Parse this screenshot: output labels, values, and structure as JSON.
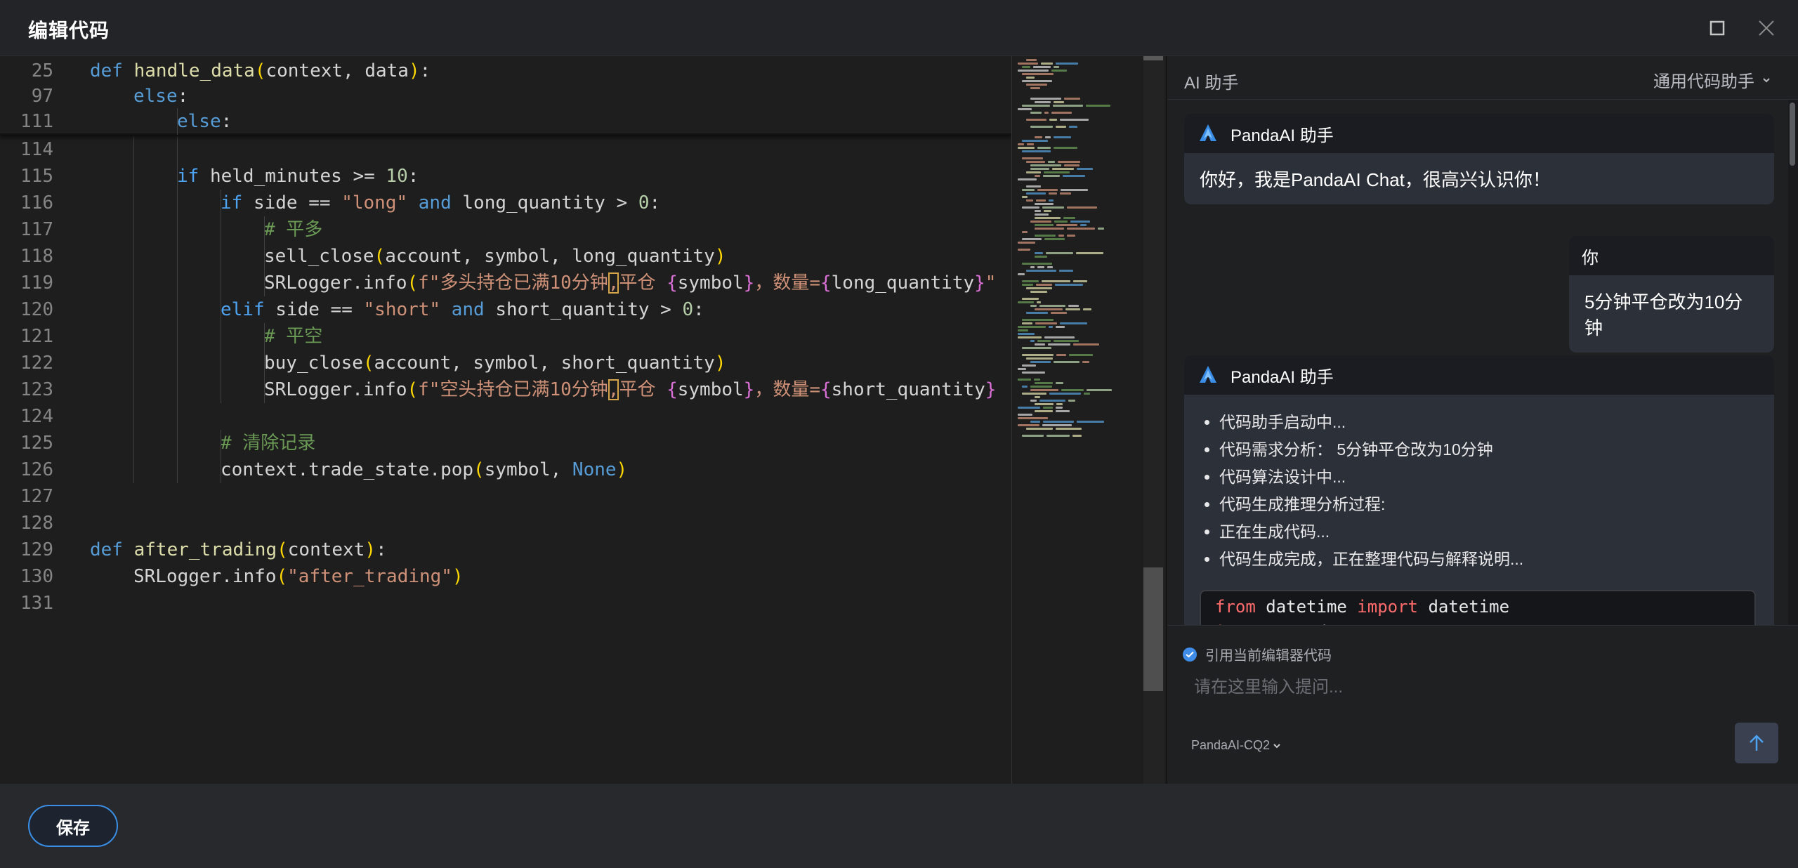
{
  "window": {
    "title": "编辑代码"
  },
  "editor": {
    "sticky_lines": [
      {
        "n": "25",
        "indent": 0,
        "tokens": [
          [
            "kw",
            "def "
          ],
          [
            "fn",
            "handle_data"
          ],
          [
            "br1",
            "("
          ],
          [
            "plain",
            "context, data"
          ],
          [
            "br1",
            ")"
          ],
          [
            "plain",
            ":"
          ]
        ]
      },
      {
        "n": "97",
        "indent": 1,
        "tokens": [
          [
            "kw",
            "else"
          ],
          [
            "plain",
            ":"
          ]
        ]
      },
      {
        "n": "111",
        "indent": 2,
        "tokens": [
          [
            "kw",
            "else"
          ],
          [
            "plain",
            ":"
          ]
        ]
      }
    ],
    "lines": [
      {
        "n": "114",
        "indent": 0,
        "tokens": []
      },
      {
        "n": "115",
        "indent": 2,
        "tokens": [
          [
            "kw2",
            "if "
          ],
          [
            "plain",
            "held_minutes >= "
          ],
          [
            "num",
            "10"
          ],
          [
            "plain",
            ":"
          ]
        ]
      },
      {
        "n": "116",
        "indent": 3,
        "tokens": [
          [
            "kw2",
            "if "
          ],
          [
            "plain",
            "side == "
          ],
          [
            "str",
            "\"long\""
          ],
          [
            "plain",
            " "
          ],
          [
            "kw",
            "and"
          ],
          [
            "plain",
            " long_quantity > "
          ],
          [
            "num",
            "0"
          ],
          [
            "plain",
            ":"
          ]
        ]
      },
      {
        "n": "117",
        "indent": 4,
        "tokens": [
          [
            "cmt",
            "# 平多"
          ]
        ]
      },
      {
        "n": "118",
        "indent": 4,
        "tokens": [
          [
            "plain",
            "sell_close"
          ],
          [
            "br1",
            "("
          ],
          [
            "plain",
            "account, symbol, long_quantity"
          ],
          [
            "br1",
            ")"
          ]
        ]
      },
      {
        "n": "119",
        "indent": 4,
        "tokens": [
          [
            "plain",
            "SRLogger.info"
          ],
          [
            "br1",
            "("
          ],
          [
            "str",
            "f\"多头持仓已满10分钟"
          ],
          [
            "hl",
            ","
          ],
          [
            "str",
            "平仓 "
          ],
          [
            "br2",
            "{"
          ],
          [
            "plain",
            "symbol"
          ],
          [
            "br2",
            "}"
          ],
          [
            "str",
            "，数量="
          ],
          [
            "br2",
            "{"
          ],
          [
            "plain",
            "long_quantity"
          ],
          [
            "br2",
            "}"
          ],
          [
            "str",
            "\""
          ]
        ]
      },
      {
        "n": "120",
        "indent": 3,
        "tokens": [
          [
            "kw2",
            "elif "
          ],
          [
            "plain",
            "side == "
          ],
          [
            "str",
            "\"short\""
          ],
          [
            "plain",
            " "
          ],
          [
            "kw",
            "and"
          ],
          [
            "plain",
            " short_quantity > "
          ],
          [
            "num",
            "0"
          ],
          [
            "plain",
            ":"
          ]
        ]
      },
      {
        "n": "121",
        "indent": 4,
        "tokens": [
          [
            "cmt",
            "# 平空"
          ]
        ]
      },
      {
        "n": "122",
        "indent": 4,
        "tokens": [
          [
            "plain",
            "buy_close"
          ],
          [
            "br1",
            "("
          ],
          [
            "plain",
            "account, symbol, short_quantity"
          ],
          [
            "br1",
            ")"
          ]
        ]
      },
      {
        "n": "123",
        "indent": 4,
        "tokens": [
          [
            "plain",
            "SRLogger.info"
          ],
          [
            "br1",
            "("
          ],
          [
            "str",
            "f\"空头持仓已满10分钟"
          ],
          [
            "hl",
            ","
          ],
          [
            "str",
            "平仓 "
          ],
          [
            "br2",
            "{"
          ],
          [
            "plain",
            "symbol"
          ],
          [
            "br2",
            "}"
          ],
          [
            "str",
            "，数量="
          ],
          [
            "br2",
            "{"
          ],
          [
            "plain",
            "short_quantity"
          ],
          [
            "br2",
            "}"
          ]
        ]
      },
      {
        "n": "124",
        "indent": 0,
        "tokens": []
      },
      {
        "n": "125",
        "indent": 3,
        "tokens": [
          [
            "cmt",
            "# 清除记录"
          ]
        ]
      },
      {
        "n": "126",
        "indent": 3,
        "tokens": [
          [
            "plain",
            "context.trade_state.pop"
          ],
          [
            "br1",
            "("
          ],
          [
            "plain",
            "symbol, "
          ],
          [
            "kw",
            "None"
          ],
          [
            "br1",
            ")"
          ]
        ]
      },
      {
        "n": "127",
        "indent": 0,
        "tokens": []
      },
      {
        "n": "128",
        "indent": 0,
        "tokens": []
      },
      {
        "n": "129",
        "indent": 0,
        "tokens": [
          [
            "kw",
            "def "
          ],
          [
            "fn",
            "after_trading"
          ],
          [
            "br1",
            "("
          ],
          [
            "plain",
            "context"
          ],
          [
            "br1",
            ")"
          ],
          [
            "plain",
            ":"
          ]
        ]
      },
      {
        "n": "130",
        "indent": 1,
        "tokens": [
          [
            "plain",
            "SRLogger.info"
          ],
          [
            "br1",
            "("
          ],
          [
            "str",
            "\"after_trading\""
          ],
          [
            "br1",
            ")"
          ]
        ]
      },
      {
        "n": "131",
        "indent": 0,
        "tokens": []
      }
    ]
  },
  "ai": {
    "header_title": "AI 助手",
    "mode_label": "通用代码助手",
    "bot_name": "PandaAI 助手",
    "greeting": "你好，我是PandaAI Chat，很高兴认识你！",
    "user_name": "你",
    "user_message": "5分钟平仓改为10分钟",
    "steps": [
      "代码助手启动中...",
      "代码需求分析： 5分钟平仓改为10分钟",
      "代码算法设计中...",
      "代码生成推理分析过程:",
      "正在生成代码...",
      "代码生成完成，正在整理代码与解释说明..."
    ],
    "code_preview": {
      "line1": {
        "k1": "from",
        "p1": " datetime ",
        "k2": "import",
        "p2": " datetime"
      },
      "line2": {
        "k1": "import",
        "p1": " pandas_quant"
      }
    },
    "ref_label": "引用当前编辑器代码",
    "input_placeholder": "请在这里输入提问...",
    "model": "PandaAI-CQ2"
  },
  "footer": {
    "save_label": "保存"
  },
  "colors": {
    "accent": "#3a8ee6",
    "keyword": "#569cd6",
    "string": "#ce9178",
    "comment": "#6a9955"
  }
}
